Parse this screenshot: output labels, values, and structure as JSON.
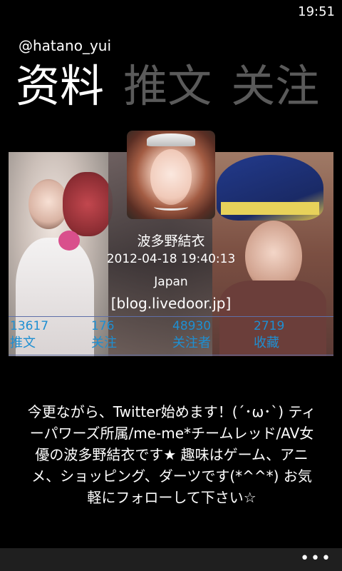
{
  "status_bar": {
    "time": "19:51"
  },
  "account": {
    "handle": "@hatano_yui"
  },
  "pivot": {
    "tabs": [
      {
        "label": "资料"
      },
      {
        "label": "推文"
      },
      {
        "label": "关注"
      }
    ]
  },
  "profile": {
    "name": "波多野結衣",
    "datetime": "2012-04-18  19:40:13",
    "location": "Japan",
    "url": "[blog.livedoor.jp]"
  },
  "stats": [
    {
      "value": "13617",
      "label": "推文"
    },
    {
      "value": "176",
      "label": "关注"
    },
    {
      "value": "48930",
      "label": "关注者"
    },
    {
      "value": "2719",
      "label": "收藏"
    }
  ],
  "bio": "今更ながら、Twitter始めます！(´･ω･`) ティーパワーズ所属/me-me*チームレッド/AV女優の波多野結衣です★ 趣味はゲーム、アニメ、ショッピング、ダーツです(*^^*) お気軽にフォローして下さい☆",
  "appbar": {
    "more_label": "•••"
  },
  "colors": {
    "accent": "#1e8fd2",
    "inactive_tab": "#5a5a5a",
    "appbar": "#1f1f1f"
  }
}
